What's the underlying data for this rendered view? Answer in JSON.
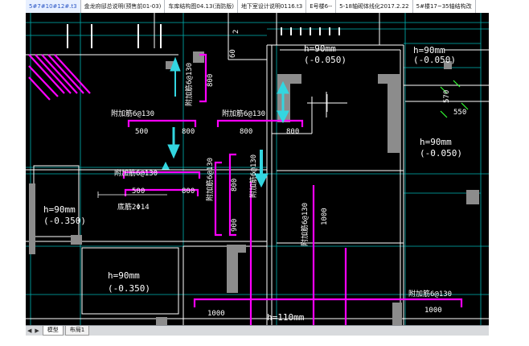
{
  "tabs": [
    {
      "label": "5#7#10#12#.t3"
    },
    {
      "label": "金龙府邸总说明(预售前01-03)"
    },
    {
      "label": "车库结构图04.13(消防版)"
    },
    {
      "label": "地下室设计说明0116.t3"
    },
    {
      "label": "E号楼6--"
    },
    {
      "label": "5-18轴砌体线化2017.2.22"
    },
    {
      "label": "5#楼17~35轴结构改"
    }
  ],
  "bottom_tabs": [
    {
      "label": "模型"
    },
    {
      "label": "布局1"
    }
  ],
  "nav": {
    "prev": "◀",
    "next": "▶"
  },
  "drawing": {
    "slab_h": "h=90mm",
    "elev_a": "(-0.050)",
    "elev_b": "(-0.350)",
    "slab_h2": "h=110mm",
    "beam_label": "附加筋6@130",
    "beam_short": "筋",
    "dim_500": "500",
    "dim_800": "800",
    "dim_900": "900",
    "dim_1000": "1000",
    "dim_550": "550",
    "dim_570": "570",
    "bar_note": "底筋2Φ14",
    "dim_60": "60",
    "dim_2": "2"
  },
  "colors": {
    "magenta": "#ff00ff",
    "cyan": "#33d6e0",
    "green": "#33ff33",
    "wall": "#8c8c8c",
    "line": "#ffffff",
    "frame": "#00c8c8"
  }
}
